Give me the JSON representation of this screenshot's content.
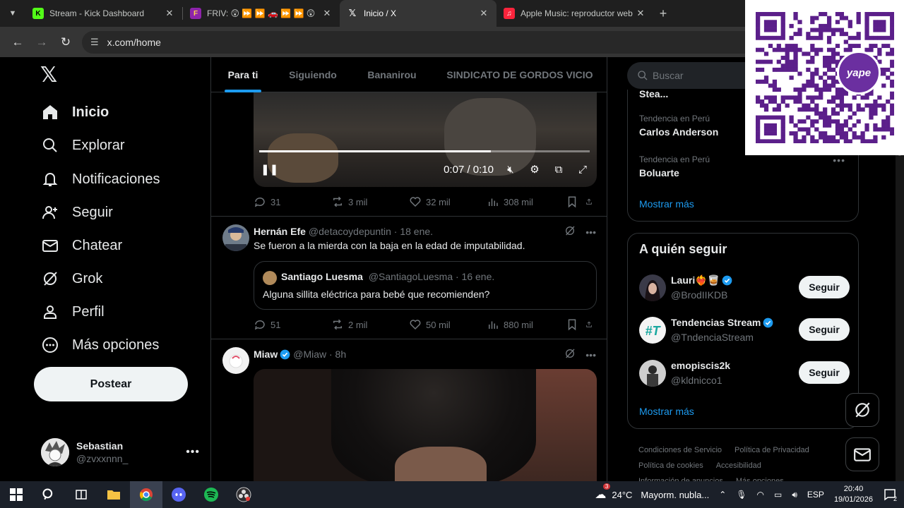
{
  "browser": {
    "tabs": [
      {
        "title": "Stream - Kick Dashboard",
        "favicon": "K",
        "color": "#53fc18"
      },
      {
        "title": "FRIV: 😲 ⏩ ⏩ 🚗 ⏩ ⏩ 😲",
        "favicon": "F",
        "color": "#8e24aa"
      },
      {
        "title": "Inicio / X",
        "favicon": "X",
        "color": "#000000"
      },
      {
        "title": "Apple Music: reproductor web",
        "favicon": "♫",
        "color": "#fa243c"
      }
    ],
    "url": "x.com/home"
  },
  "sidebar": {
    "nav": [
      {
        "label": "Inicio",
        "icon": "home-icon"
      },
      {
        "label": "Explorar",
        "icon": "search-icon"
      },
      {
        "label": "Notificaciones",
        "icon": "bell-icon"
      },
      {
        "label": "Seguir",
        "icon": "add-user-icon"
      },
      {
        "label": "Chatear",
        "icon": "mail-icon"
      },
      {
        "label": "Grok",
        "icon": "grok-icon"
      },
      {
        "label": "Perfil",
        "icon": "person-icon"
      },
      {
        "label": "Más opciones",
        "icon": "more-circle-icon"
      }
    ],
    "post_button": "Postear",
    "profile": {
      "name": "Sebastian",
      "handle": "@zvxxnnn_"
    }
  },
  "timeline": {
    "tabs": [
      "Para ti",
      "Siguiendo",
      "Bananirou",
      "SINDICATO DE GORDOS VICIO"
    ],
    "video1": {
      "time": "0:07 / 0:10",
      "progress": 0.7
    },
    "post0_stats": {
      "replies": "31",
      "reposts": "3 mil",
      "likes": "32 mil",
      "views": "308 mil"
    },
    "post1": {
      "name": "Hernán Efe",
      "meta": "@detacoydepuntin · 18 ene.",
      "text": "Se fueron a la mierda con la baja en la edad de imputabilidad.",
      "quote": {
        "name": "Santiago Luesma",
        "meta": "@SantiagoLuesma · 16 ene.",
        "text": "Alguna sillita eléctrica para bebé que recomienden?"
      },
      "stats": {
        "replies": "51",
        "reposts": "2 mil",
        "likes": "50 mil",
        "views": "880 mil"
      }
    },
    "post2": {
      "name": "Miaw",
      "meta": "@Miaw · 8h"
    }
  },
  "right": {
    "search_placeholder": "Buscar",
    "partial_trend": "Stea...",
    "trends": [
      {
        "category": "Tendencia en Perú",
        "name": "Carlos Anderson"
      },
      {
        "category": "Tendencia en Perú",
        "name": "Boluarte"
      }
    ],
    "show_more": "Mostrar más",
    "who_title": "A quién seguir",
    "who": [
      {
        "name": "Lauri❤️‍🔥🥃",
        "handle": "@BrodIIKDB",
        "button": "Seguir"
      },
      {
        "name": "Tendencias Stream",
        "handle": "@TndenciaStream",
        "button": "Seguir"
      },
      {
        "name": "emopiscis2k",
        "handle": "@kldnicco1",
        "button": "Seguir"
      }
    ],
    "footer": [
      "Condiciones de Servicio",
      "Política de Privacidad",
      "Política de cookies",
      "Accesibilidad",
      "Información de anuncios",
      "Más opciones ..."
    ]
  },
  "taskbar": {
    "temperature": "24°C",
    "weather": "Mayorm. nubla...",
    "lang": "ESP",
    "time": "20:40",
    "date": "19/01/2026",
    "weather_badge": "3",
    "notif_count": "2"
  },
  "qr": {
    "brand": "yape"
  },
  "colors": {
    "accent": "#1d9bf0",
    "bg": "#000000",
    "border": "#2f3336",
    "muted": "#71767b"
  }
}
